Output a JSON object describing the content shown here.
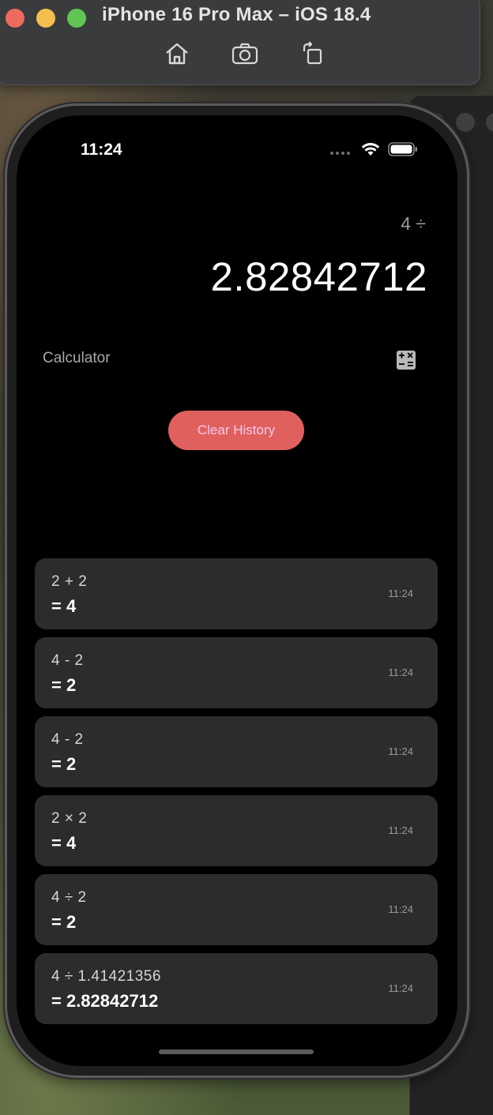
{
  "simulator": {
    "title": "iPhone 16 Pro Max – iOS 18.4",
    "tools": [
      "home-icon",
      "screenshot-icon",
      "rotate-icon"
    ]
  },
  "status_bar": {
    "time": "11:24",
    "icons": [
      "signal-icon",
      "wifi-icon",
      "battery-icon"
    ]
  },
  "display": {
    "expression": "4 ÷",
    "result": "2.82842712"
  },
  "app": {
    "label": "Calculator",
    "icon": "calculator-icon"
  },
  "clear_history": {
    "label": "Clear History",
    "color": "#e0605e"
  },
  "history": [
    {
      "expression": "2 + 2",
      "result": "= 4",
      "time": "11:24"
    },
    {
      "expression": "4 - 2",
      "result": "= 2",
      "time": "11:24"
    },
    {
      "expression": "4 - 2",
      "result": "= 2",
      "time": "11:24"
    },
    {
      "expression": "2 × 2",
      "result": "= 4",
      "time": "11:24"
    },
    {
      "expression": "4 ÷ 2",
      "result": "= 2",
      "time": "11:24"
    },
    {
      "expression": "4 ÷ 1.41421356",
      "result": "= 2.82842712",
      "time": "11:24"
    }
  ]
}
